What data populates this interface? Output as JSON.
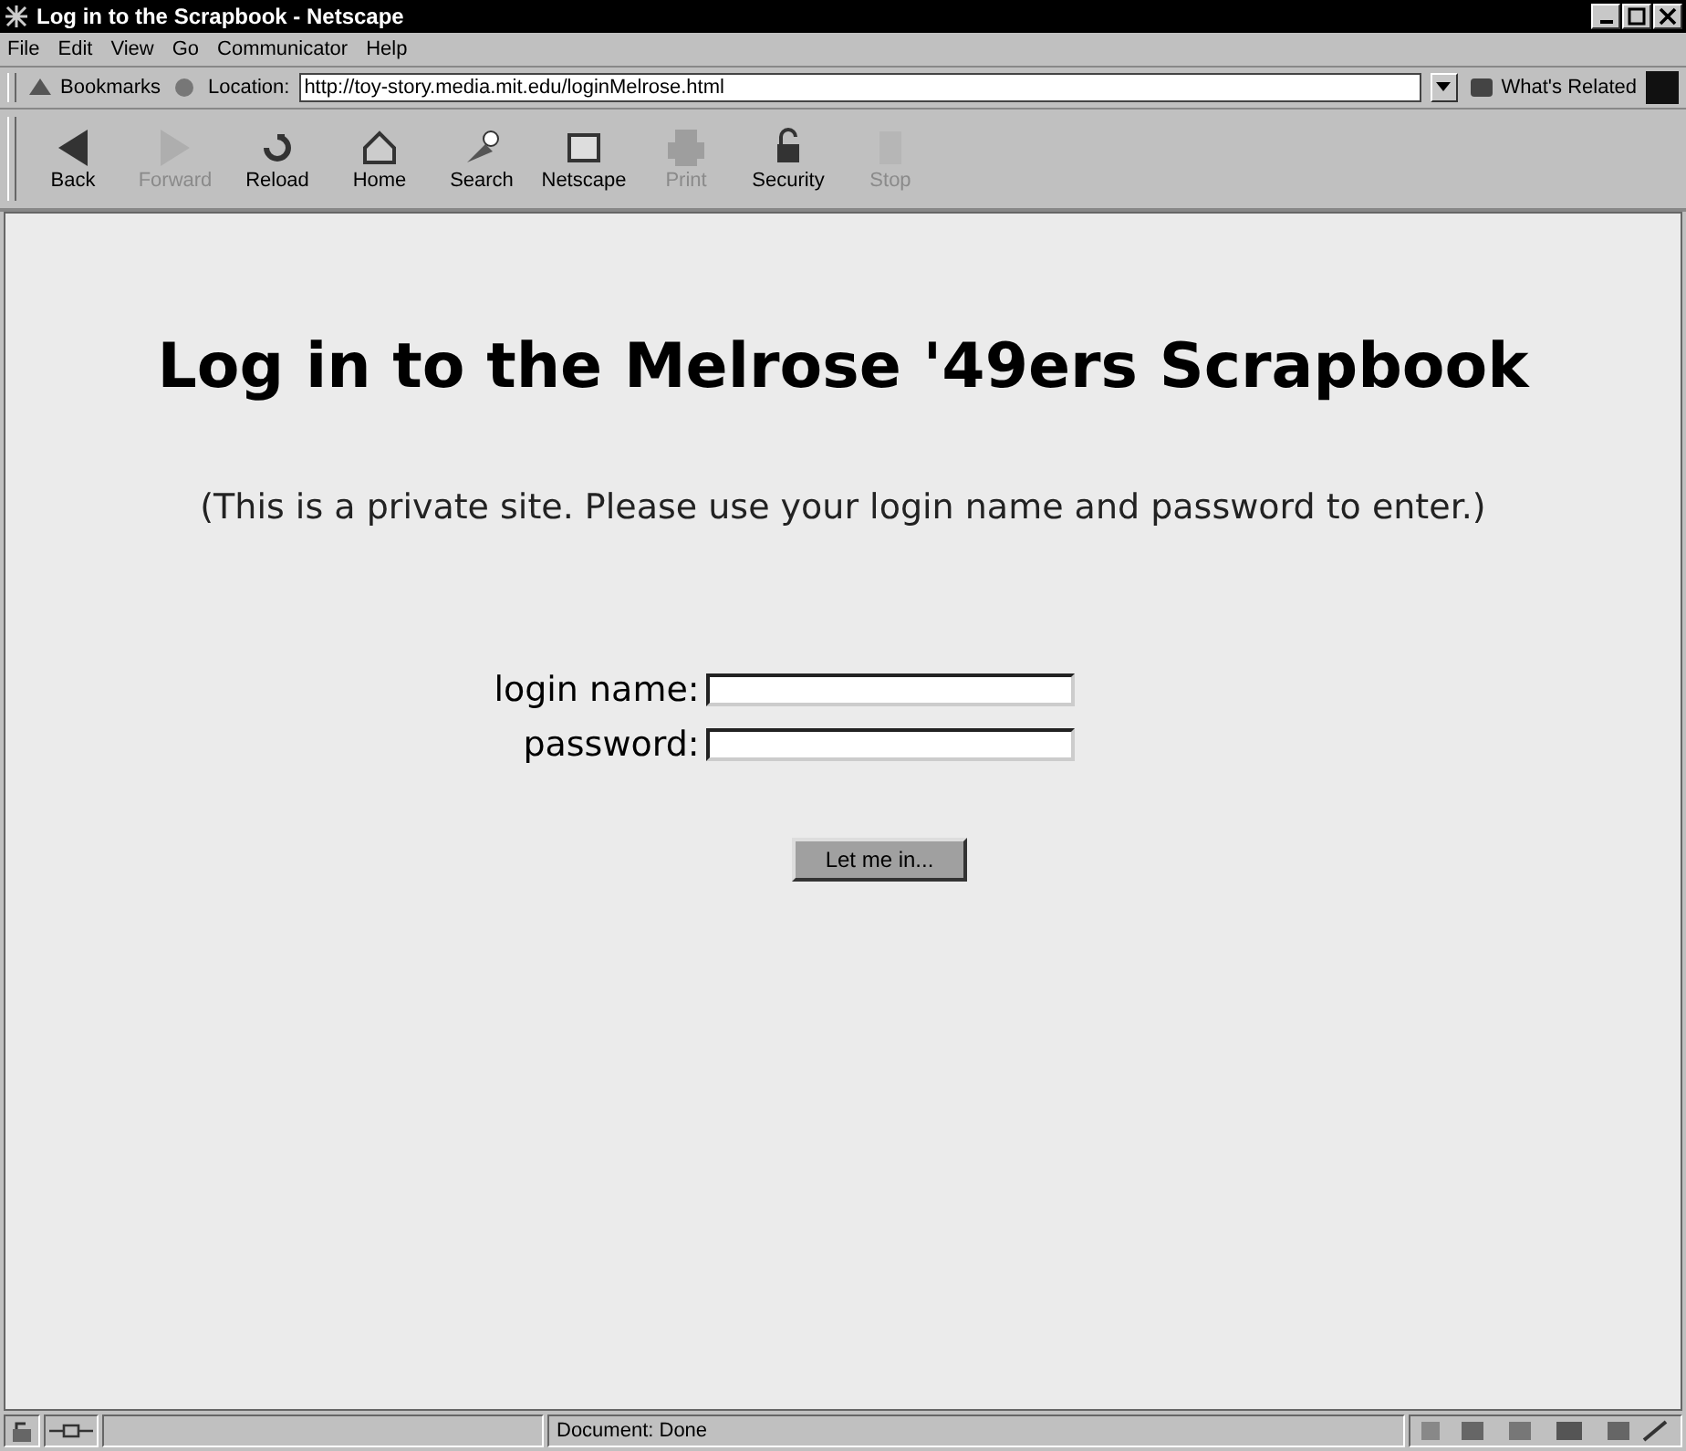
{
  "window": {
    "title": "Log in to the Scrapbook - Netscape"
  },
  "menu": [
    "File",
    "Edit",
    "View",
    "Go",
    "Communicator",
    "Help"
  ],
  "location_bar": {
    "bookmarks": "Bookmarks",
    "location_label": "Location:",
    "url": "http://toy-story.media.mit.edu/loginMelrose.html",
    "related": "What's Related"
  },
  "toolbar": [
    {
      "label": "Back",
      "disabled": false
    },
    {
      "label": "Forward",
      "disabled": true
    },
    {
      "label": "Reload",
      "disabled": false
    },
    {
      "label": "Home",
      "disabled": false
    },
    {
      "label": "Search",
      "disabled": false
    },
    {
      "label": "Netscape",
      "disabled": false
    },
    {
      "label": "Print",
      "disabled": true
    },
    {
      "label": "Security",
      "disabled": false
    },
    {
      "label": "Stop",
      "disabled": true
    }
  ],
  "page": {
    "heading": "Log in to the Melrose '49ers Scrapbook",
    "note": "(This is a private site. Please use your login name and password to enter.)",
    "fields": [
      {
        "label": "login name:"
      },
      {
        "label": "password:"
      }
    ],
    "submit": "Let me in..."
  },
  "status_bar": {
    "text": "Document: Done"
  }
}
